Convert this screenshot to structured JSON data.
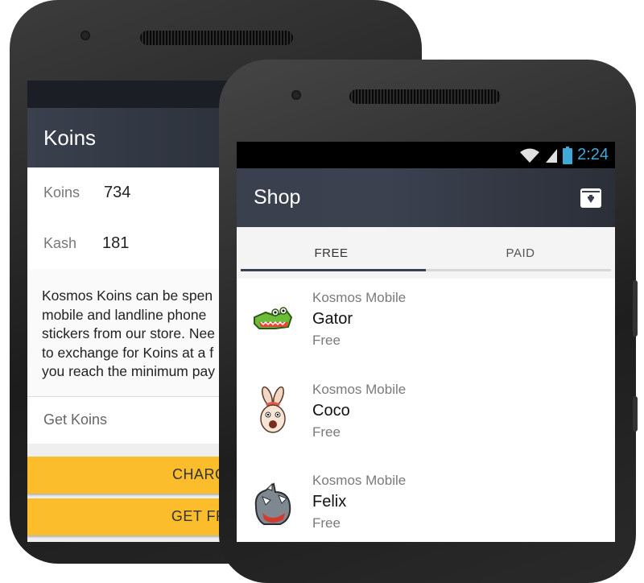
{
  "back_phone": {
    "title": "Koins",
    "balances": [
      {
        "label": "Koins",
        "value": "734"
      },
      {
        "label": "Kash",
        "value": "181"
      }
    ],
    "description_lines": [
      "Kosmos Koins can be spen",
      "mobile and landline phone",
      "stickers from our store. Nee",
      "to exchange for Koins at a f",
      "you reach the minimum pay"
    ],
    "get_koins_label": "Get Koins",
    "buttons": [
      "CHARGE",
      "GET FRE"
    ]
  },
  "front_phone": {
    "status_bar": {
      "time": "2:24"
    },
    "app_bar": {
      "title": "Shop",
      "action_icon": "archive-download-icon"
    },
    "tabs": [
      {
        "label": "FREE",
        "active": true
      },
      {
        "label": "PAID",
        "active": false
      }
    ],
    "items": [
      {
        "publisher": "Kosmos Mobile",
        "name": "Gator",
        "price": "Free",
        "icon": "gator-sticker-icon"
      },
      {
        "publisher": "Kosmos Mobile",
        "name": "Coco",
        "price": "Free",
        "icon": "bunny-sticker-icon"
      },
      {
        "publisher": "Kosmos Mobile",
        "name": "Felix",
        "price": "Free",
        "icon": "rhino-sticker-icon"
      }
    ]
  },
  "colors": {
    "app_bar": "#3a404d",
    "accent_button": "#fbbd2c",
    "status_time": "#3fa9d8",
    "tab_indicator": "#3a4150"
  }
}
